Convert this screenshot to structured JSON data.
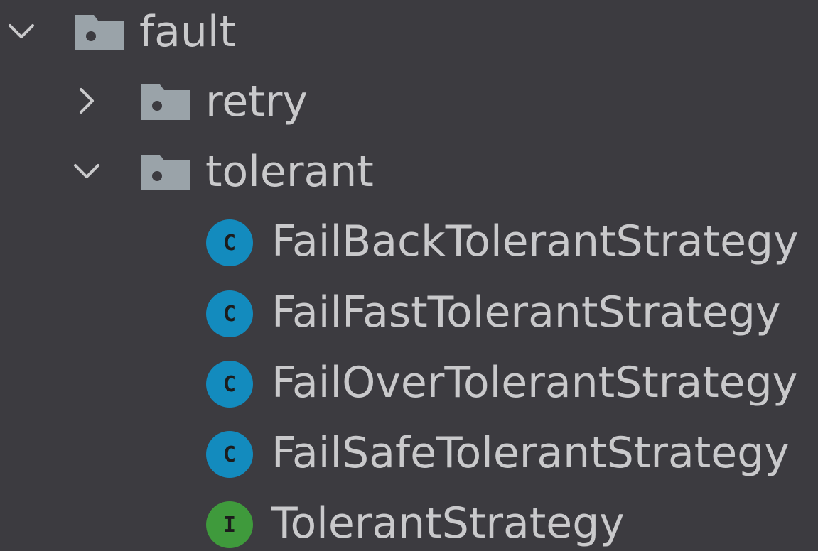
{
  "tree": {
    "root": {
      "label": "fault",
      "icon": "folder-icon",
      "expanded": true
    },
    "children": [
      {
        "label": "retry",
        "icon": "folder-icon",
        "expanded": false
      },
      {
        "label": "tolerant",
        "icon": "folder-icon",
        "expanded": true
      }
    ],
    "files": [
      {
        "label": "FailBackTolerantStrategy",
        "type_letter": "C",
        "icon": "class-icon"
      },
      {
        "label": "FailFastTolerantStrategy",
        "type_letter": "C",
        "icon": "class-icon"
      },
      {
        "label": "FailOverTolerantStrategy",
        "type_letter": "C",
        "icon": "class-icon"
      },
      {
        "label": "FailSafeTolerantStrategy",
        "type_letter": "C",
        "icon": "class-icon"
      },
      {
        "label": "TolerantStrategy",
        "type_letter": "I",
        "icon": "interface-icon"
      }
    ]
  },
  "colors": {
    "background": "#3c3b40",
    "text": "#c9c9cb",
    "folder": "#9aa3a9",
    "class_badge": "#138bbe",
    "interface_badge": "#3f9a3c"
  }
}
